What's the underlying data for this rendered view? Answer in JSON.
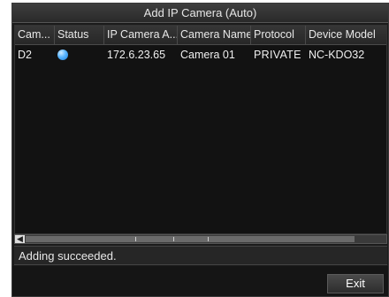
{
  "dialog": {
    "title": "Add IP Camera (Auto)"
  },
  "table": {
    "columns": [
      "Cam...",
      "Status",
      "IP Camera A...",
      "Camera Name",
      "Protocol",
      "Device Model"
    ],
    "rows": [
      {
        "camera": "D2",
        "status_icon": "status-dot-icon",
        "status_color": "#3a9cf2",
        "ip": "172.6.23.65",
        "name": "Camera 01",
        "protocol": "PRIVATE",
        "model": "NC-KDO32"
      }
    ]
  },
  "status": {
    "message": "Adding succeeded."
  },
  "footer": {
    "exit_label": "Exit"
  }
}
